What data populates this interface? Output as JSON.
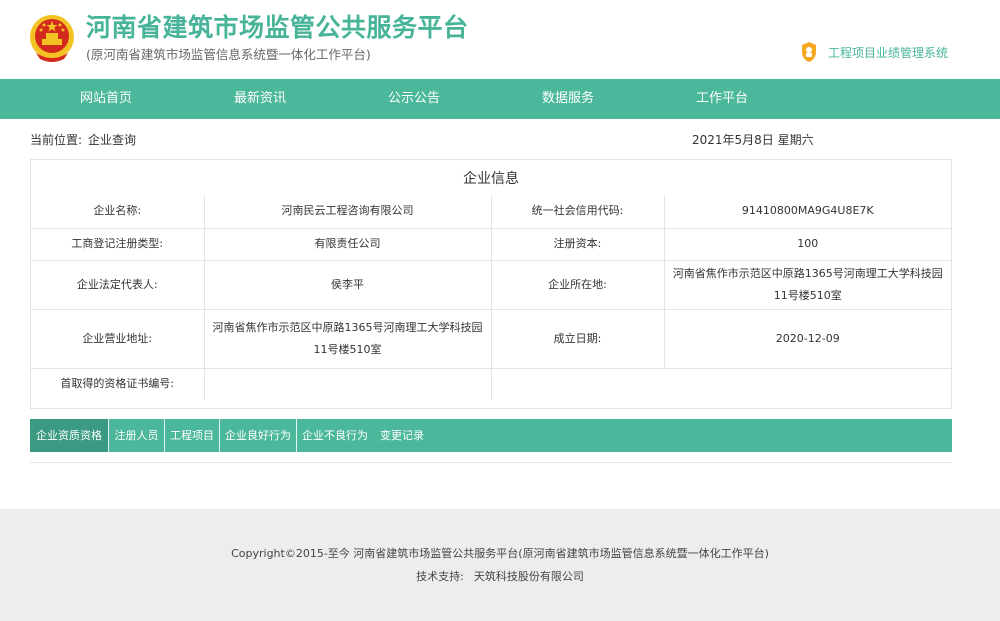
{
  "header": {
    "title": "河南省建筑市场监管公共服务平台",
    "subtitle": "(原河南省建筑市场监管信息系统暨一体化工作平台)",
    "project_link": "工程项目业绩管理系统",
    "colors": {
      "brand": "#47b49a",
      "nav": "#4bb79b",
      "emblem_red": "#d42a1e",
      "emblem_gold": "#f3c324"
    }
  },
  "nav": {
    "items": [
      {
        "label": "网站首页"
      },
      {
        "label": "最新资讯"
      },
      {
        "label": "公示公告"
      },
      {
        "label": "数据服务"
      },
      {
        "label": "工作平台"
      }
    ]
  },
  "breadcrumb": {
    "prefix": "当前位置:",
    "current": "企业查询",
    "date": "2021年5月8日 星期六"
  },
  "company": {
    "section_title": "企业信息",
    "rows": [
      {
        "label1": "企业名称:",
        "value1": "河南民云工程咨询有限公司",
        "label2": "统一社会信用代码:",
        "value2": "91410800MA9G4U8E7K"
      },
      {
        "label1": "工商登记注册类型:",
        "value1": "有限责任公司",
        "label2": "注册资本:",
        "value2": "100"
      },
      {
        "label1": "企业法定代表人:",
        "value1": "侯李平",
        "label2": "企业所在地:",
        "value2": "河南省焦作市示范区中原路1365号河南理工大学科技园11号楼510室"
      },
      {
        "label1": "企业营业地址:",
        "value1": "河南省焦作市示范区中原路1365号河南理工大学科技园11号楼510室",
        "label2": "成立日期:",
        "value2": "2020-12-09"
      },
      {
        "label1": "首取得的资格证书编号:",
        "value1": "",
        "label2": "",
        "value2": ""
      }
    ]
  },
  "tabs": [
    {
      "label": "企业资质资格",
      "active": true
    },
    {
      "label": "注册人员",
      "active": false
    },
    {
      "label": "工程项目",
      "active": false
    },
    {
      "label": "企业良好行为",
      "active": false
    },
    {
      "label": "企业不良行为",
      "active": false
    },
    {
      "label": "变更记录",
      "active": false
    }
  ],
  "footer": {
    "copyright": "Copyright©2015-至今 河南省建筑市场监管公共服务平台(原河南省建筑市场监管信息系统暨一体化工作平台)",
    "support_label": "技术支持:",
    "support_value": "天筑科技股份有限公司"
  }
}
